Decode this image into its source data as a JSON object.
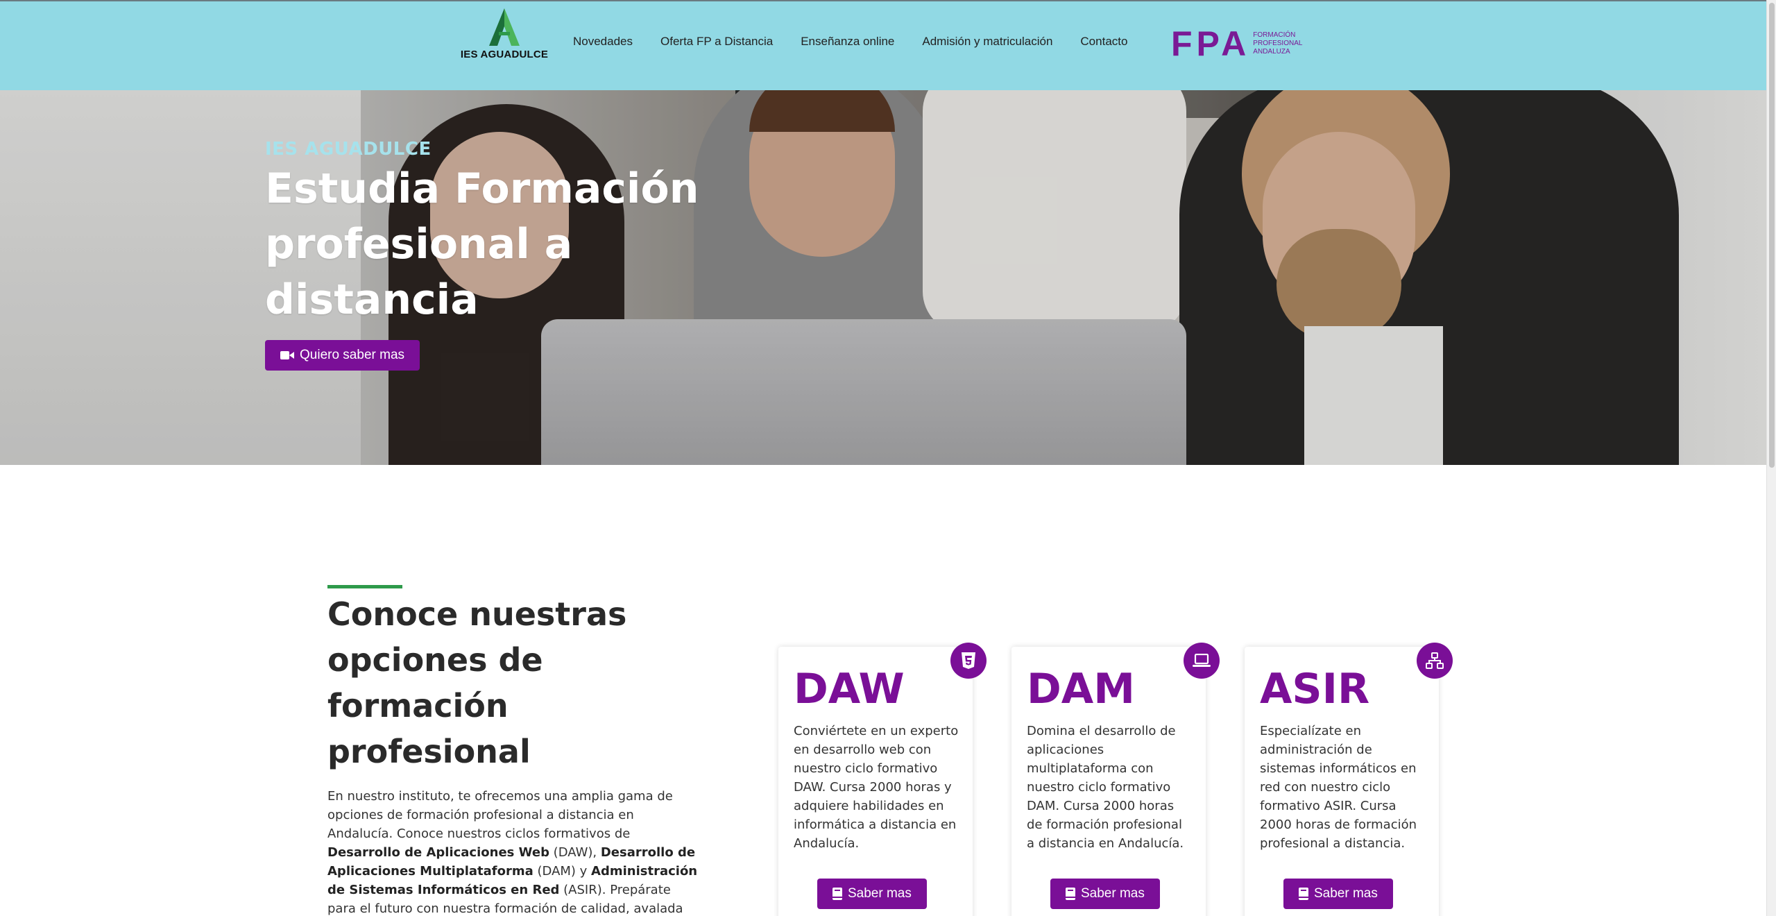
{
  "header": {
    "logo_text": "IES AGUADULCE",
    "nav": [
      {
        "label": "Novedades"
      },
      {
        "label": "Oferta FP a Distancia"
      },
      {
        "label": "Enseñanza online"
      },
      {
        "label": "Admisión y matriculación"
      },
      {
        "label": "Contacto"
      }
    ],
    "partner_logo": {
      "mark": "FPA",
      "line1": "Formación",
      "line2": "Profesional",
      "line3": "Andaluza"
    }
  },
  "hero": {
    "kicker": "IES AGUADULCE",
    "title": "Estudia Formación profesional a distancia",
    "button_label": "Quiero saber mas",
    "button_icon": "video-camera-icon"
  },
  "section": {
    "title": "Conoce nuestras opciones de formación profesional",
    "body": {
      "p1": "En nuestro instituto, te ofrecemos una amplia gama de opciones de formación profesional a distancia en Andalucía. Conoce nuestros ciclos formativos de ",
      "b1": "Desarrollo de Aplicaciones Web",
      "p2": " (DAW), ",
      "b2": "Desarrollo de Aplicaciones Multiplataforma",
      "p3": " (DAM) y ",
      "b3": "Administración de Sistemas Informáticos en Red",
      "p4": " (ASIR). Prepárate para el futuro con nuestra formación de calidad, avalada por la"
    }
  },
  "cards": [
    {
      "title": "DAW",
      "icon": "css3-icon",
      "text": "Conviértete en un experto en desarrollo web con nuestro ciclo formativo DAW. Cursa 2000 horas y adquiere habilidades en informática a distancia en Andalucía.",
      "button_label": "Saber mas"
    },
    {
      "title": "DAM",
      "icon": "laptop-icon",
      "text": "Domina el desarrollo de aplicaciones multiplataforma con nuestro ciclo formativo DAM. Cursa 2000 horas de formación profesional a distancia en Andalucía.",
      "button_label": "Saber mas"
    },
    {
      "title": "ASIR",
      "icon": "network-icon",
      "text": "Especialízate en administración de sistemas informáticos en red con nuestro ciclo formativo ASIR. Cursa 2000 horas de formación profesional a distancia.",
      "button_label": "Saber mas"
    }
  ],
  "colors": {
    "header_bg": "#91d9e4",
    "accent_purple": "#7a0f97",
    "accent_green": "#2e9a4a",
    "kicker": "#a6e2ec"
  }
}
